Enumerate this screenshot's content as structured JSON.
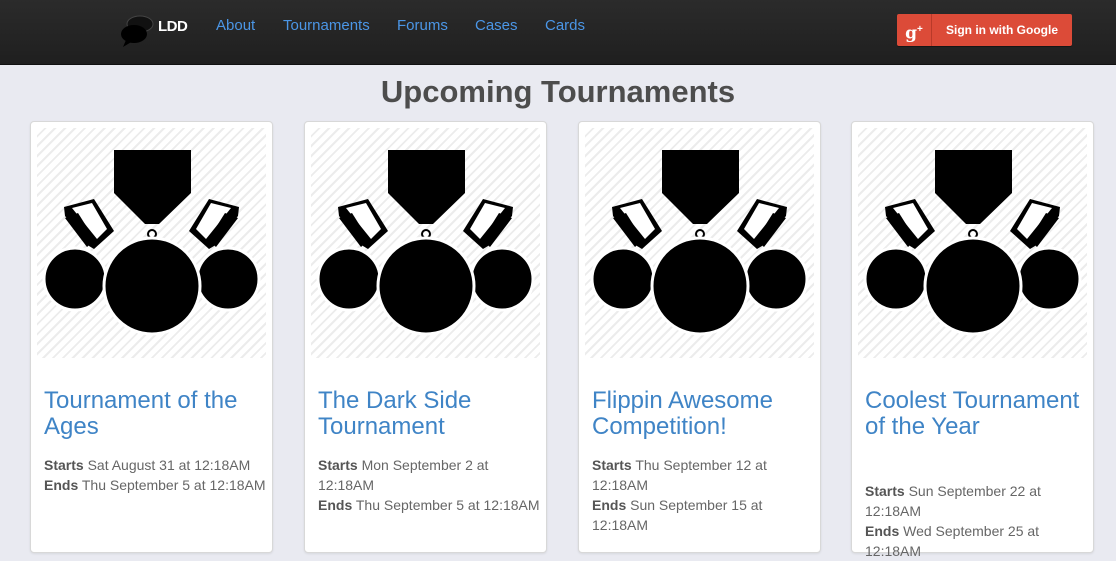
{
  "navbar": {
    "brand": "LDD",
    "links": [
      "About",
      "Tournaments",
      "Forums",
      "Cases",
      "Cards"
    ],
    "signin_label": "Sign in with Google",
    "google_glyph": "g",
    "google_plus": "+"
  },
  "page": {
    "title": "Upcoming Tournaments"
  },
  "labels": {
    "starts": "Starts",
    "ends": "Ends"
  },
  "tournaments": [
    {
      "name": "Tournament of the Ages",
      "starts": "Sat August 31 at 12:18AM",
      "ends": "Thu September 5 at 12:18AM"
    },
    {
      "name": "The Dark Side Tournament",
      "starts": "Mon September 2 at 12:18AM",
      "ends": "Thu September 5 at 12:18AM"
    },
    {
      "name": "Flippin Awesome Competition!",
      "starts": "Thu September 12 at 12:18AM",
      "ends": "Sun September 15 at 12:18AM"
    },
    {
      "name": "Coolest Tournament of the Year",
      "starts": "Sun September 22 at 12:18AM",
      "ends": "Wed September 25 at 12:18AM"
    }
  ],
  "colors": {
    "accent": "#3f84c6",
    "nav_link": "#4b96e6",
    "google": "#dc4b38"
  },
  "icons": {
    "brand": "chat-bubbles-icon",
    "thumbnail": "medals-icon"
  }
}
